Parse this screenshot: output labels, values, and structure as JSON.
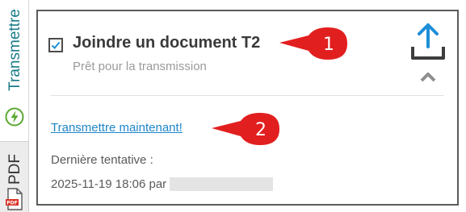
{
  "sidebar": {
    "tabs": [
      {
        "label": "Transmettre",
        "icon": "lightning-circle-icon"
      },
      {
        "label": "PDF",
        "icon": "pdf-file-icon"
      }
    ]
  },
  "card": {
    "checkbox_checked": true,
    "title": "Joindre un document T2",
    "subtitle": "Prêt pour la transmission",
    "upload_icon": "upload-tray-icon",
    "collapse_icon": "chevron-up-icon",
    "transmit_link": "Transmettre maintenant!",
    "last_attempt_label": "Dernière tentative :",
    "last_attempt_value": "2025-11-19 18:06 par"
  },
  "callouts": [
    "1",
    "2"
  ],
  "colors": {
    "accent_teal": "#1a7b88",
    "link_blue": "#1f86c9",
    "upload_blue": "#1e8fd6",
    "callout_red": "#e21f1f",
    "lightning_green": "#5aa832"
  }
}
